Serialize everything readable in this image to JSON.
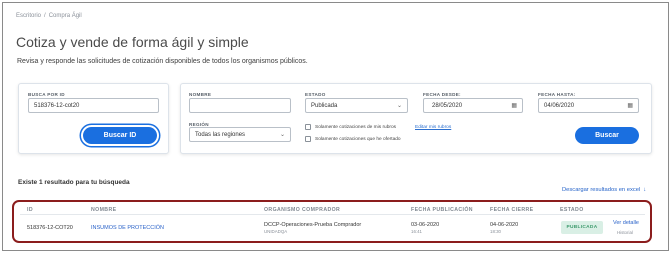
{
  "breadcrumb": {
    "home": "Escritorio",
    "separator": "/",
    "current": "Compra Ágil"
  },
  "page": {
    "title": "Cotiza y vende de forma ágil y simple",
    "subtitle": "Revisa y responde las solicitudes de cotización disponibles de todos los organismos públicos."
  },
  "search_id": {
    "label": "BUSCA POR ID",
    "value": "518376-12-cot20",
    "button": "Buscar ID"
  },
  "filters": {
    "nombre_label": "NOMBRE",
    "nombre_value": "",
    "estado_label": "ESTADO",
    "estado_value": "Publicada",
    "desde_label": "FECHA DESDE:",
    "desde_value": "28/05/2020",
    "hasta_label": "FECHA HASTA:",
    "hasta_value": "04/06/2020",
    "region_label": "REGIÓN",
    "region_value": "Todas las regiones",
    "chk_rubros": "Solamente cotizaciones de mis rubros",
    "edit_rubros": "Editar mis rubros",
    "chk_ofertado": "Solamente cotizaciones que he ofertado",
    "button": "Buscar"
  },
  "results": {
    "summary": "Existe 1 resultado para tu búsqueda",
    "download": "Descargar resultados en excel",
    "columns": [
      "ID",
      "NOMBRE",
      "ORGANISMO COMPRADOR",
      "FECHA PUBLICACIÓN",
      "FECHA CIERRE",
      "ESTADO"
    ],
    "rows": [
      {
        "id": "518376-12-COT20",
        "nombre": "INSUMOS DE PROTECCIÓN",
        "organismo": "DCCP-Operaciones-Prueba Comprador",
        "unidad": "UNIDADQA",
        "pub_fecha": "03-06-2020",
        "pub_hora": "16:41",
        "cierre_fecha": "04-06-2020",
        "cierre_hora": "18:30",
        "estado": "PUBLICADA",
        "ver_detalle": "Ver detalle",
        "historial": "Historial"
      }
    ]
  },
  "colors": {
    "primary": "#1a6fe0",
    "highlight_border": "#8b1d1d",
    "badge_bg": "#d9efe5",
    "badge_text": "#3c9a6c"
  }
}
